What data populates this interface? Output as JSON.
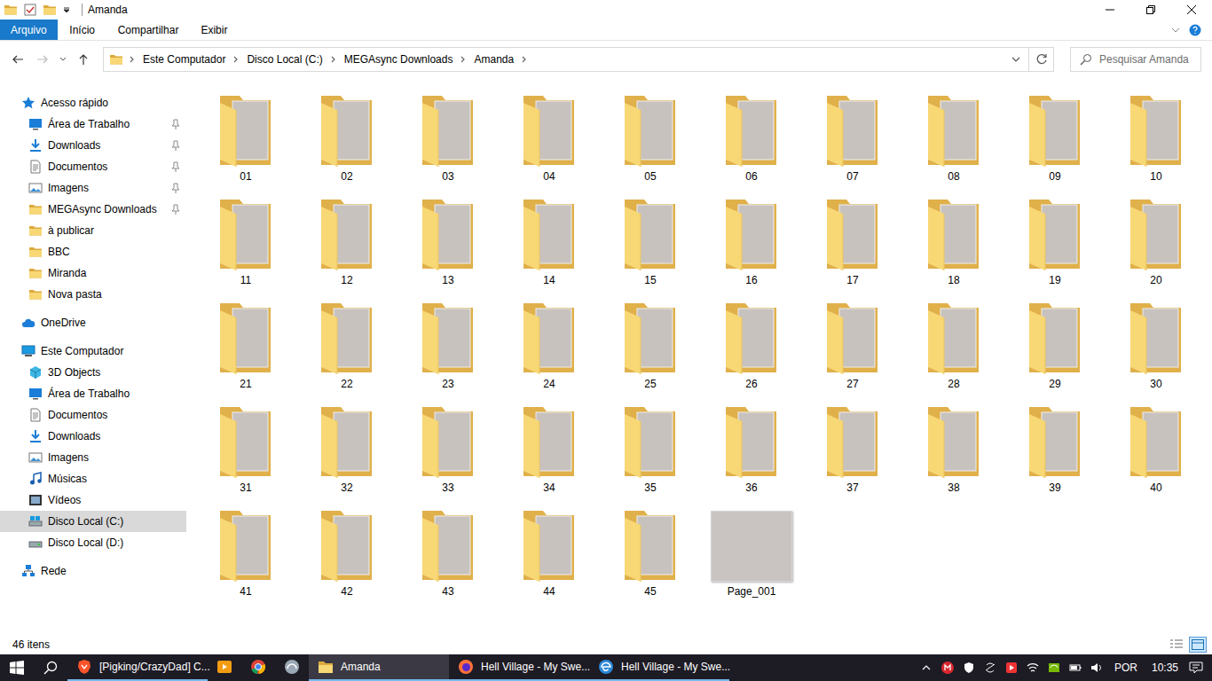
{
  "window": {
    "title": "Amanda"
  },
  "ribbon": {
    "tabs": [
      {
        "label": "Arquivo",
        "selected": true
      },
      {
        "label": "Início",
        "selected": false
      },
      {
        "label": "Compartilhar",
        "selected": false
      },
      {
        "label": "Exibir",
        "selected": false
      }
    ]
  },
  "address": {
    "crumbs": [
      "Este Computador",
      "Disco Local (C:)",
      "MEGAsync Downloads",
      "Amanda"
    ]
  },
  "search": {
    "placeholder": "Pesquisar Amanda"
  },
  "sidebar": {
    "groups": [
      {
        "label": "Acesso rápido",
        "kind": "star",
        "selected": false,
        "items": [
          {
            "label": "Área de Trabalho",
            "kind": "desktop",
            "pinned": true,
            "selected": false
          },
          {
            "label": "Downloads",
            "kind": "download",
            "pinned": true,
            "selected": false
          },
          {
            "label": "Documentos",
            "kind": "doc",
            "pinned": true,
            "selected": false
          },
          {
            "label": "Imagens",
            "kind": "image",
            "pinned": true,
            "selected": false
          },
          {
            "label": "MEGAsync Downloads",
            "kind": "folder",
            "pinned": true,
            "selected": false
          },
          {
            "label": "à publicar",
            "kind": "folder",
            "pinned": false,
            "selected": false
          },
          {
            "label": "BBC",
            "kind": "folder",
            "pinned": false,
            "selected": false
          },
          {
            "label": "Miranda",
            "kind": "folder",
            "pinned": false,
            "selected": false
          },
          {
            "label": "Nova pasta",
            "kind": "folder",
            "pinned": false,
            "selected": false
          }
        ]
      },
      {
        "label": "OneDrive",
        "kind": "cloud",
        "selected": false,
        "items": []
      },
      {
        "label": "Este Computador",
        "kind": "pc",
        "selected": false,
        "items": [
          {
            "label": "3D Objects",
            "kind": "cube",
            "pinned": false,
            "selected": false
          },
          {
            "label": "Área de Trabalho",
            "kind": "desktop",
            "pinned": false,
            "selected": false
          },
          {
            "label": "Documentos",
            "kind": "doc",
            "pinned": false,
            "selected": false
          },
          {
            "label": "Downloads",
            "kind": "download",
            "pinned": false,
            "selected": false
          },
          {
            "label": "Imagens",
            "kind": "image",
            "pinned": false,
            "selected": false
          },
          {
            "label": "Músicas",
            "kind": "music",
            "pinned": false,
            "selected": false
          },
          {
            "label": "Vídeos",
            "kind": "video",
            "pinned": false,
            "selected": false
          },
          {
            "label": "Disco Local (C:)",
            "kind": "drive-c",
            "pinned": false,
            "selected": true
          },
          {
            "label": "Disco Local (D:)",
            "kind": "drive",
            "pinned": false,
            "selected": false
          }
        ]
      },
      {
        "label": "Rede",
        "kind": "network",
        "selected": false,
        "items": []
      }
    ]
  },
  "files": [
    {
      "label": "01",
      "kind": "folder"
    },
    {
      "label": "02",
      "kind": "folder"
    },
    {
      "label": "03",
      "kind": "folder"
    },
    {
      "label": "04",
      "kind": "folder"
    },
    {
      "label": "05",
      "kind": "folder"
    },
    {
      "label": "06",
      "kind": "folder"
    },
    {
      "label": "07",
      "kind": "folder"
    },
    {
      "label": "08",
      "kind": "folder"
    },
    {
      "label": "09",
      "kind": "folder"
    },
    {
      "label": "10",
      "kind": "folder"
    },
    {
      "label": "11",
      "kind": "folder"
    },
    {
      "label": "12",
      "kind": "folder"
    },
    {
      "label": "13",
      "kind": "folder"
    },
    {
      "label": "14",
      "kind": "folder"
    },
    {
      "label": "15",
      "kind": "folder"
    },
    {
      "label": "16",
      "kind": "folder"
    },
    {
      "label": "17",
      "kind": "folder"
    },
    {
      "label": "18",
      "kind": "folder"
    },
    {
      "label": "19",
      "kind": "folder"
    },
    {
      "label": "20",
      "kind": "folder"
    },
    {
      "label": "21",
      "kind": "folder"
    },
    {
      "label": "22",
      "kind": "folder"
    },
    {
      "label": "23",
      "kind": "folder"
    },
    {
      "label": "24",
      "kind": "folder"
    },
    {
      "label": "25",
      "kind": "folder"
    },
    {
      "label": "26",
      "kind": "folder"
    },
    {
      "label": "27",
      "kind": "folder"
    },
    {
      "label": "28",
      "kind": "folder"
    },
    {
      "label": "29",
      "kind": "folder"
    },
    {
      "label": "30",
      "kind": "folder"
    },
    {
      "label": "31",
      "kind": "folder"
    },
    {
      "label": "32",
      "kind": "folder"
    },
    {
      "label": "33",
      "kind": "folder"
    },
    {
      "label": "34",
      "kind": "folder"
    },
    {
      "label": "35",
      "kind": "folder"
    },
    {
      "label": "36",
      "kind": "folder"
    },
    {
      "label": "37",
      "kind": "folder"
    },
    {
      "label": "38",
      "kind": "folder"
    },
    {
      "label": "39",
      "kind": "folder"
    },
    {
      "label": "40",
      "kind": "folder"
    },
    {
      "label": "41",
      "kind": "folder"
    },
    {
      "label": "42",
      "kind": "folder"
    },
    {
      "label": "43",
      "kind": "folder"
    },
    {
      "label": "44",
      "kind": "folder"
    },
    {
      "label": "45",
      "kind": "folder"
    },
    {
      "label": "Page_001",
      "kind": "image"
    }
  ],
  "status_bar": {
    "count": "46 itens",
    "views": [
      {
        "kind": "details",
        "selected": false
      },
      {
        "kind": "large-icons",
        "selected": true
      }
    ]
  },
  "taskbar": {
    "apps": [
      {
        "kind": "brave",
        "label": "[Pigking/CrazyDad] C...",
        "selected": false
      },
      {
        "kind": "media",
        "selected": false
      },
      {
        "kind": "chrome",
        "selected": false
      },
      {
        "kind": "app",
        "selected": false
      },
      {
        "kind": "explorer",
        "label": "Amanda",
        "selected": true
      },
      {
        "kind": "firefox",
        "label": "Hell Village - My Swe...",
        "selected": false
      },
      {
        "kind": "edge",
        "label": "Hell Village - My Swe...",
        "selected": false
      }
    ],
    "tray": {
      "icons": [
        "chevron",
        "mega",
        "shield",
        "sync",
        "app-red",
        "wifi",
        "nvidia",
        "battery",
        "volume"
      ],
      "language": "POR",
      "time": "10:35"
    }
  }
}
